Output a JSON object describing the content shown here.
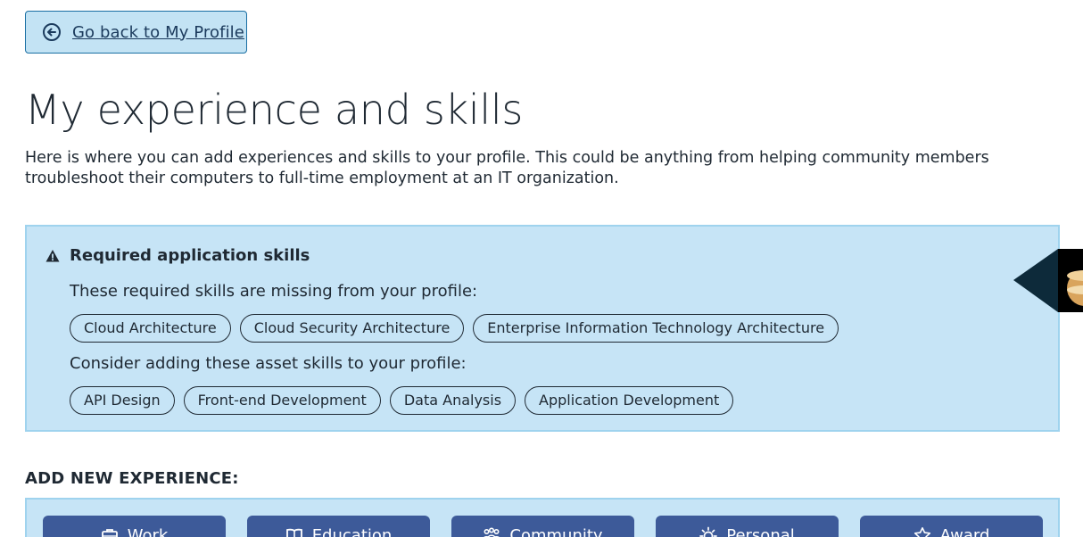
{
  "back_button": {
    "label": "Go back to My Profile",
    "icon": "circle-arrow-left-icon"
  },
  "page": {
    "title": "My experience and skills",
    "intro": "Here is where you can add experiences and skills to your profile. This could be anything from helping community members troubleshoot their computers to full-time employment at an IT organization."
  },
  "alert": {
    "icon": "warning-triangle-icon",
    "title": "Required application skills",
    "missing_label": "These required skills are missing from your profile:",
    "missing_skills": [
      "Cloud Architecture",
      "Cloud Security Architecture",
      "Enterprise Information Technology Architecture"
    ],
    "asset_label": "Consider adding these asset skills to your profile:",
    "asset_skills": [
      "API Design",
      "Front-end Development",
      "Data Analysis",
      "Application Development"
    ]
  },
  "cookie_tab": {
    "icon": "cookie-icon"
  },
  "add_experience": {
    "heading": "ADD NEW EXPERIENCE:",
    "buttons": [
      {
        "label": "Work",
        "icon": "briefcase-icon"
      },
      {
        "label": "Education",
        "icon": "book-icon"
      },
      {
        "label": "Community",
        "icon": "people-icon"
      },
      {
        "label": "Personal",
        "icon": "sun-icon"
      },
      {
        "label": "Award",
        "icon": "star-icon"
      }
    ]
  },
  "colors": {
    "alert_bg": "#c6e4f6",
    "alert_border": "#9fd3ee",
    "button_bg": "#3d5a99",
    "back_button_bg": "#c3e3f4",
    "text": "#1f2933"
  }
}
